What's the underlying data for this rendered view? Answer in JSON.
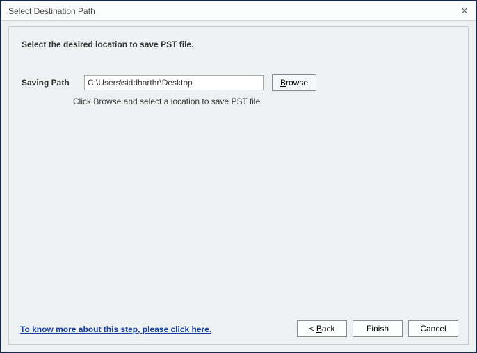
{
  "titlebar": {
    "title": "Select Destination Path",
    "close_glyph": "✕"
  },
  "heading": "Select the desired location to save PST file.",
  "form": {
    "saving_path_label": "Saving Path",
    "saving_path_value": "C:\\Users\\siddharthr\\Desktop",
    "browse_prefix": "B",
    "browse_rest": "rowse",
    "hint": "Click Browse and select a location to save PST file"
  },
  "footer": {
    "link_text": "To know more about this step, please click here.",
    "back_prefix": "< ",
    "back_u": "B",
    "back_rest": "ack",
    "finish_label": "Finish",
    "cancel_label": "Cancel"
  }
}
